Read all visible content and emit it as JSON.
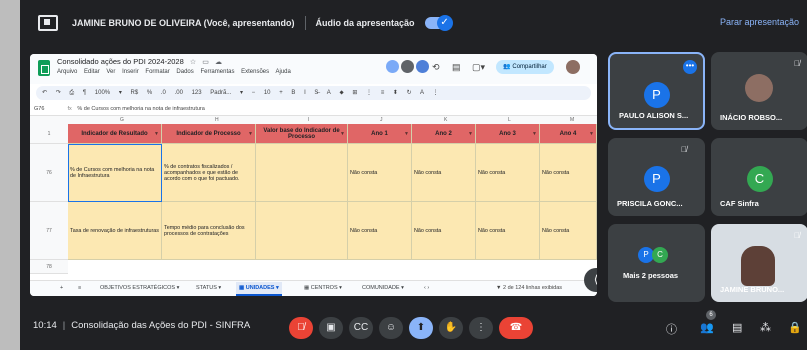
{
  "present_bar": {
    "presenter_text": "JAMINE BRUNO DE OLIVEIRA (Você, apresentando)",
    "audio_label": "Áudio da apresentação",
    "stop_label": "Parar apresentação"
  },
  "sheet": {
    "title": "Consolidado ações do PDI 2024-2028",
    "menus": [
      "Arquivo",
      "Editar",
      "Ver",
      "Inserir",
      "Formatar",
      "Dados",
      "Ferramentas",
      "Extensões",
      "Ajuda"
    ],
    "share_label": "Compartilhar",
    "toolbar": [
      "↶",
      "↷",
      "⎙",
      "¶",
      "100%",
      "▾",
      "R$",
      "%",
      ".0",
      ".00",
      "123",
      "Padrã...",
      "▾",
      "−",
      "10",
      "+",
      "B",
      "I",
      "S̶",
      "A",
      "⬥",
      "⊞",
      "⋮",
      "≡",
      "⬍",
      "↻",
      "A",
      "⋮"
    ],
    "cell_ref": "G76",
    "formula": "% de Cursos com melhoria na nota de infraestrutura",
    "col_letters": [
      "G",
      "H",
      "I",
      "J",
      "K",
      "L",
      "M"
    ],
    "row_numbers": [
      "1",
      "76",
      "77",
      "78"
    ],
    "headers": [
      "Indicador de Resultado",
      "Indicador de Processo",
      "Valor base do Indicador de Processo",
      "Ano 1",
      "Ano 2",
      "Ano 3",
      "Ano 4"
    ],
    "rows": [
      [
        "% de Cursos com melhoria na nota de Infraestrutura",
        "% de contratos fiscalizados / acompanhados e que estão de acordo com o que foi pactuado.",
        "",
        "Não consta",
        "Não consta",
        "Não consta",
        "Não consta"
      ],
      [
        "Taxa de renovação de infraestruturas",
        "Tempo médio para conclusão dos processos de contratações",
        "",
        "Não consta",
        "Não consta",
        "Não consta",
        "Não consta"
      ]
    ],
    "tabs": [
      "OBJETIVOS ESTRATÉGICOS",
      "STATUS",
      "UNIDADES",
      "CENTROS",
      "COMUNIDADE"
    ],
    "active_tab": "UNIDADES",
    "row_count": "2 de 124 linhas exibidas"
  },
  "participants": [
    {
      "name": "PAULO ALISON S...",
      "initial": "P",
      "color": "#1a73e8"
    },
    {
      "name": "INÁCIO ROBSO..."
    },
    {
      "name": "PRISCILA GONC...",
      "initial": "P",
      "color": "#1a73e8"
    },
    {
      "name": "CAF Sinfra",
      "initial": "C",
      "color": "#33a852"
    },
    {
      "name": "Mais 2 pessoas",
      "initials": [
        "P",
        "C"
      ]
    },
    {
      "name": "JAMINE BRUNO..."
    }
  ],
  "bottom": {
    "time": "10:14",
    "meeting_title": "Consolidação das Ações do PDI - SINFRA",
    "people_badge": "6"
  }
}
